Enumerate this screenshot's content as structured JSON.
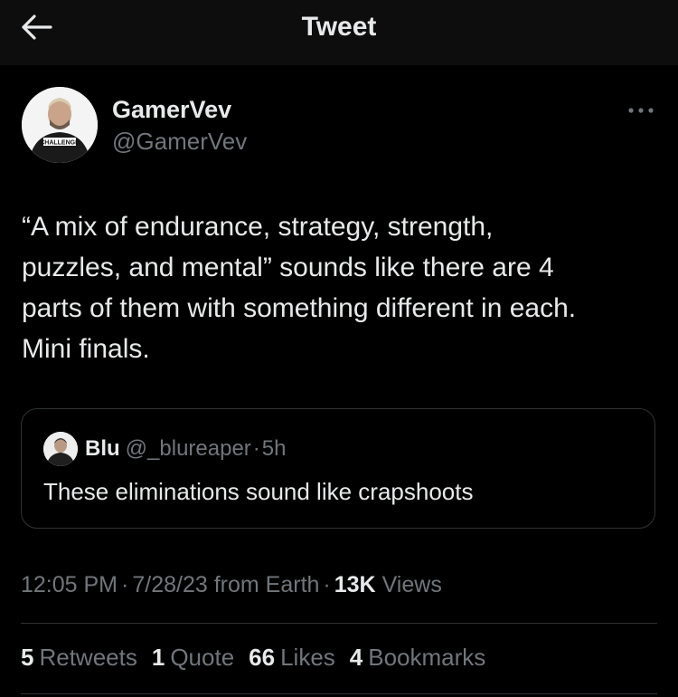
{
  "header": {
    "title": "Tweet",
    "back_icon": "arrow-left-icon"
  },
  "author": {
    "name": "GamerVev",
    "handle": "@GamerVev",
    "avatar_shirt_text": "CHALLENGE",
    "more_icon": "more-horizontal-icon"
  },
  "tweet": {
    "text": "“A mix of endurance, strategy, strength,\npuzzles, and mental” sounds like there are 4\nparts of them with something different in each.\nMini finals."
  },
  "quote": {
    "name": "Blu",
    "handle": "@_blureaper",
    "separator": "·",
    "time": "5h",
    "text": "These eliminations sound like crapshoots"
  },
  "meta": {
    "time": "12:05 PM",
    "sep1": "·",
    "date": "7/28/23",
    "from": "from Earth",
    "sep2": "·",
    "views_count": "13K",
    "views_label": "Views"
  },
  "stats": {
    "retweets_count": "5",
    "retweets_label": "Retweets",
    "quotes_count": "1",
    "quotes_label": "Quote",
    "likes_count": "66",
    "likes_label": "Likes",
    "bookmarks_count": "4",
    "bookmarks_label": "Bookmarks"
  },
  "colors": {
    "background": "#000000",
    "header_bg": "#0d0d0d",
    "primary_text": "#e7e9ea",
    "secondary_text": "#71767b",
    "border": "#2f3336"
  }
}
